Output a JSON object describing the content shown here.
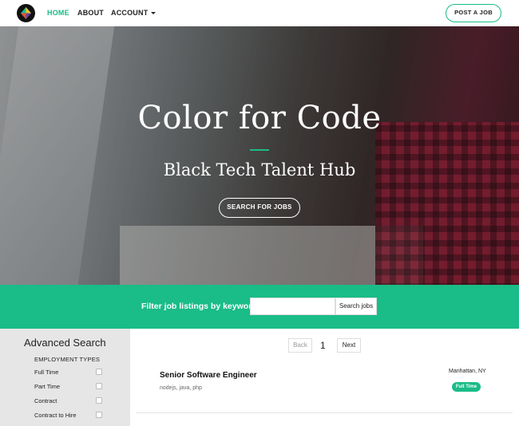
{
  "nav": {
    "links": [
      {
        "label": "HOME"
      },
      {
        "label": "ABOUT"
      },
      {
        "label": "ACCOUNT"
      }
    ],
    "post_job_label": "POST A JOB",
    "accent_color": "#1abc87"
  },
  "hero": {
    "title": "Color for Code",
    "subtitle": "Black Tech Talent Hub",
    "button_label": "SEARCH FOR JOBS"
  },
  "filter": {
    "label": "Filter job listings by keyword",
    "input_value": "",
    "button_label": "Search jobs"
  },
  "sidebar": {
    "title": "Advanced Search",
    "subtitle": "EMPLOYMENT TYPES",
    "options": [
      {
        "label": "Full Time",
        "checked": false
      },
      {
        "label": "Part Time",
        "checked": false
      },
      {
        "label": "Contract",
        "checked": false
      },
      {
        "label": "Contract to Hire",
        "checked": false
      }
    ]
  },
  "pager": {
    "back_label": "Back",
    "page": "1",
    "next_label": "Next"
  },
  "jobs": [
    {
      "title": "Senior Software Engineer",
      "tags": "nodejs, java, php",
      "location": "Manhattan, NY",
      "type": "Full Time"
    }
  ]
}
